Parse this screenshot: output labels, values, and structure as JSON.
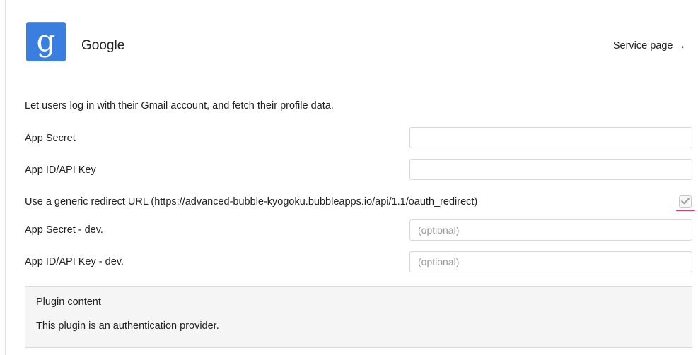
{
  "header": {
    "service_name": "Google",
    "service_link": "Service page →",
    "logo_icon": "google-g-icon",
    "logo_color": "#3a7fe0"
  },
  "description": "Let users log in with their Gmail account, and fetch their profile data.",
  "fields": {
    "app_secret": {
      "label": "App Secret",
      "value": "",
      "placeholder": ""
    },
    "app_id": {
      "label": "App ID/API Key",
      "value": "",
      "placeholder": ""
    },
    "redirect": {
      "label": "Use a generic redirect URL (https://advanced-bubble-kyogoku.bubbleapps.io/api/1.1/oauth_redirect)",
      "checked": true,
      "check_icon": "checkmark-icon"
    },
    "app_secret_dev": {
      "label": "App Secret - dev.",
      "value": "",
      "placeholder": "(optional)"
    },
    "app_id_dev": {
      "label": "App ID/API Key - dev.",
      "value": "",
      "placeholder": "(optional)"
    }
  },
  "plugin": {
    "title": "Plugin content",
    "text": "This plugin is an authentication provider."
  },
  "colors": {
    "highlight_underline": "#e8337a"
  }
}
